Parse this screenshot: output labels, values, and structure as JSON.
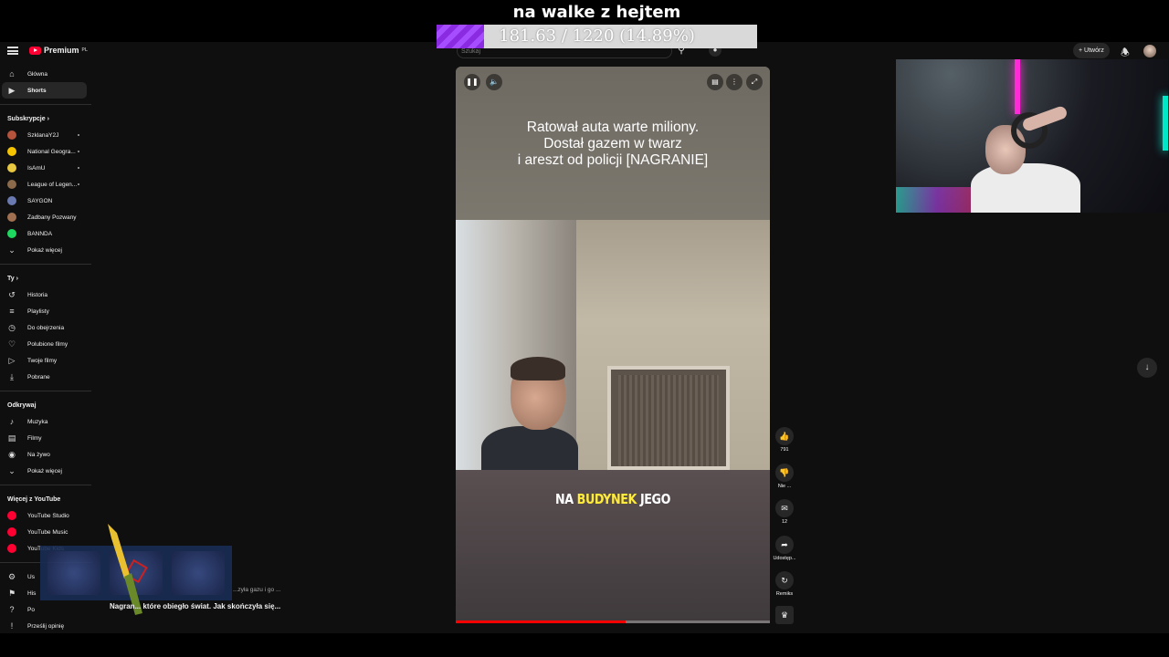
{
  "overlay": {
    "goal_title": "na walke z hejtem",
    "goal_text": "181.63 / 1220 (14.89%)",
    "goal_fraction": 0.1489
  },
  "masthead": {
    "logo_text": "Premium",
    "logo_region": "PL",
    "search_placeholder": "Szukaj",
    "create_label": "Utwórz"
  },
  "sidebar": {
    "main": [
      {
        "label": "Główna",
        "icon": "home-icon"
      },
      {
        "label": "Shorts",
        "icon": "shorts-icon",
        "active": true
      }
    ],
    "subs_heading": "Subskrypcje",
    "subscriptions": [
      {
        "label": "SzklanaY2J",
        "color": "#b5533c",
        "live": true
      },
      {
        "label": "National Geogra...",
        "color": "#f5c400",
        "live": true
      },
      {
        "label": "IsAmU",
        "color": "#e8c840",
        "live": true
      },
      {
        "label": "League of Legen...",
        "color": "#8a6a4a",
        "live": true
      },
      {
        "label": "SAYGON",
        "color": "#6a7ab0",
        "live": false
      },
      {
        "label": "Zadbany Pozwany",
        "color": "#a07050",
        "live": false
      },
      {
        "label": "BANNDA",
        "color": "#1ed760",
        "live": false
      }
    ],
    "subs_more": "Pokaż więcej",
    "you_heading": "Ty",
    "you": [
      {
        "label": "Historia",
        "icon": "history-icon"
      },
      {
        "label": "Playlisty",
        "icon": "playlist-icon"
      },
      {
        "label": "Do obejrzenia",
        "icon": "watch-later-icon"
      },
      {
        "label": "Polubione filmy",
        "icon": "like-icon"
      },
      {
        "label": "Twoje filmy",
        "icon": "your-videos-icon"
      },
      {
        "label": "Pobrane",
        "icon": "download-icon"
      }
    ],
    "explore_heading": "Odkrywaj",
    "explore": [
      {
        "label": "Muzyka",
        "icon": "music-icon"
      },
      {
        "label": "Filmy",
        "icon": "movies-icon"
      },
      {
        "label": "Na żywo",
        "icon": "live-icon"
      }
    ],
    "explore_more": "Pokaż więcej",
    "more_heading": "Więcej z YouTube",
    "more": [
      {
        "label": "YouTube Studio"
      },
      {
        "label": "YouTube Music"
      },
      {
        "label": "YouTube Kids"
      }
    ],
    "bottom": [
      {
        "label": "Us",
        "icon": "settings-icon"
      },
      {
        "label": "His",
        "icon": "flag-icon"
      },
      {
        "label": "Po",
        "icon": "help-icon"
      },
      {
        "label": "Prześlij opinię",
        "icon": "feedback-icon"
      }
    ]
  },
  "short": {
    "headline": "Ratował auta warte miliony.\nDostał gazem w twarz\ni areszt od policji [NAGRANIE]",
    "caption_pre": "NA ",
    "caption_hl": "BUDYNEK",
    "caption_post": " JEGO",
    "progress_fraction": 0.54
  },
  "actions": {
    "like_count": "791",
    "dislike_label": "Nie ...",
    "comments_count": "12",
    "share_label": "Udostęp...",
    "remix_label": "Remiks"
  },
  "overlay_bottom": {
    "toast_line1": "...zyła gazu i go ...",
    "toast_line2": "Nagran... które obiegło świat. Jak skończyła się..."
  },
  "colors": {
    "accent": "#ff0033",
    "goal_purple": "#a64dff",
    "highlight": "#ffeb3b"
  }
}
